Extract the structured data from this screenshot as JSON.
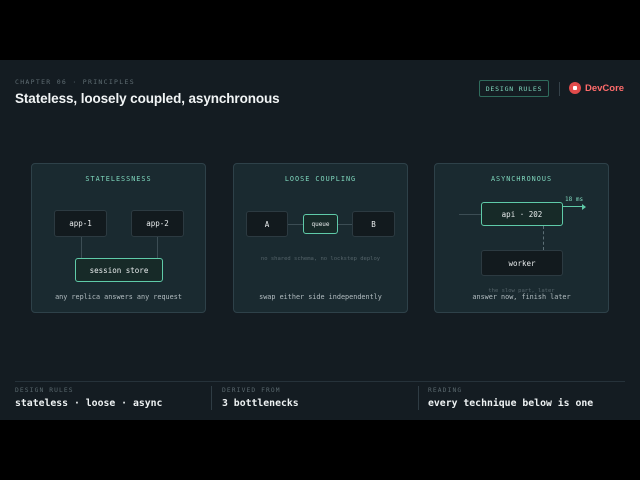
{
  "header": {
    "kicker": "CHAPTER 06 · PRINCIPLES",
    "title": "Stateless, loosely coupled, asynchronous",
    "badge": "DESIGN RULES",
    "brand": "DevCore"
  },
  "cards": [
    {
      "title": "STATELESSNESS",
      "nodes": [
        "app-1",
        "app-2",
        "session store"
      ],
      "caption": "any replica answers any request"
    },
    {
      "title": "LOOSE COUPLING",
      "nodes": [
        "A",
        "queue",
        "B"
      ],
      "note": "no shared schema, no lockstep deploy",
      "caption": "swap either side independently"
    },
    {
      "title": "ASYNCHRONOUS",
      "latency": "18 ms",
      "nodes": [
        "api · 202",
        "worker"
      ],
      "note": "the slow part, later",
      "caption": "answer now, finish later"
    }
  ],
  "footer": [
    {
      "label": "DESIGN RULES",
      "value": "stateless · loose · async"
    },
    {
      "label": "DERIVED FROM",
      "value": "3 bottlenecks"
    },
    {
      "label": "READING",
      "value": "every technique below is one"
    }
  ],
  "colors": {
    "accent": "#7fd7bd",
    "brand": "#ff6b6b",
    "background": "#141c22",
    "card": "#1a2a30"
  }
}
